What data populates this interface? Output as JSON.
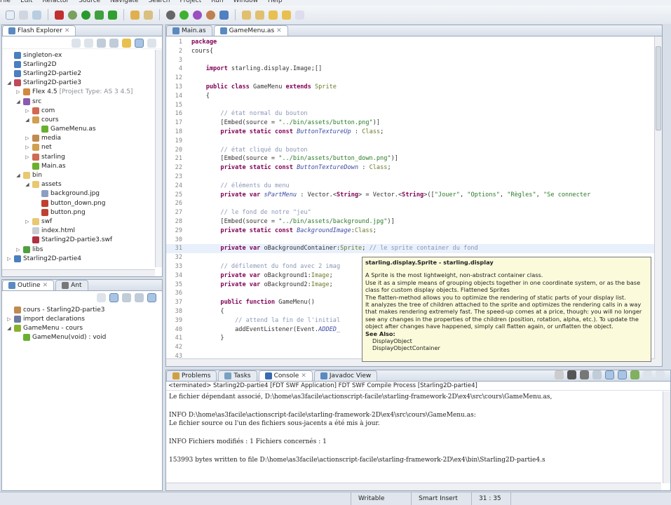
{
  "menu": [
    "File",
    "Edit",
    "Refactor",
    "Source",
    "Navigate",
    "Search",
    "Project",
    "Run",
    "Window",
    "Help"
  ],
  "explorer": {
    "tab": "Flash Explorer",
    "items": [
      {
        "label": "singleton-ex",
        "depth": 0,
        "tw": "",
        "icon": "#4a7fc0"
      },
      {
        "label": "Starling2D",
        "depth": 0,
        "tw": "",
        "icon": "#4a7fc0"
      },
      {
        "label": "Starling2D-partie2",
        "depth": 0,
        "tw": "",
        "icon": "#4a7fc0"
      },
      {
        "label": "Starling2D-partie3",
        "depth": 0,
        "tw": "◢",
        "icon": "#c04a5a"
      },
      {
        "label": "Flex 4.5",
        "extra": "[Project Type: AS 3 4.5]",
        "depth": 1,
        "tw": "▷",
        "icon": "#d08a40"
      },
      {
        "label": "src",
        "depth": 1,
        "tw": "◢",
        "icon": "#8a5ab0"
      },
      {
        "label": "com",
        "depth": 2,
        "tw": "▷",
        "icon": "#d06a50"
      },
      {
        "label": "cours",
        "depth": 2,
        "tw": "◢",
        "icon": "#d0a050"
      },
      {
        "label": "GameMenu.as",
        "depth": 3,
        "tw": "",
        "icon": "#6ab030"
      },
      {
        "label": "media",
        "depth": 2,
        "tw": "▷",
        "icon": "#c08a50"
      },
      {
        "label": "net",
        "depth": 2,
        "tw": "▷",
        "icon": "#d0a050"
      },
      {
        "label": "starling",
        "depth": 2,
        "tw": "▷",
        "icon": "#d06a50"
      },
      {
        "label": "Main.as",
        "depth": 2,
        "tw": "",
        "icon": "#6ab030"
      },
      {
        "label": "bin",
        "depth": 1,
        "tw": "◢",
        "icon": "#e8c870"
      },
      {
        "label": "assets",
        "depth": 2,
        "tw": "◢",
        "icon": "#e8c870"
      },
      {
        "label": "background.jpg",
        "depth": 3,
        "tw": "",
        "icon": "#8aa0c0"
      },
      {
        "label": "button_down.png",
        "depth": 3,
        "tw": "",
        "icon": "#c04030"
      },
      {
        "label": "button.png",
        "depth": 3,
        "tw": "",
        "icon": "#c04030"
      },
      {
        "label": "swf",
        "depth": 2,
        "tw": "▷",
        "icon": "#e8c870"
      },
      {
        "label": "index.html",
        "depth": 2,
        "tw": "",
        "icon": "#c8ccd4"
      },
      {
        "label": "Starling2D-partie3.swf",
        "depth": 2,
        "tw": "",
        "icon": "#b03040"
      },
      {
        "label": "libs",
        "depth": 1,
        "tw": "▷",
        "icon": "#50a040"
      },
      {
        "label": "Starling2D-partie4",
        "depth": 0,
        "tw": "▷",
        "icon": "#4a7fc0"
      }
    ]
  },
  "outline": {
    "tabs": [
      "Outline",
      "Ant"
    ],
    "items": [
      {
        "label": "cours - Starling2D-partie3",
        "depth": 0,
        "tw": "",
        "icon": "#c08a50"
      },
      {
        "label": "import declarations",
        "depth": 0,
        "tw": "▷",
        "icon": "#6a7aa0"
      },
      {
        "label": "GameMenu - cours",
        "depth": 0,
        "tw": "◢",
        "icon": "#8ab030"
      },
      {
        "label": "GameMenu(void) : void",
        "depth": 1,
        "tw": "",
        "icon": "#6ab030"
      }
    ]
  },
  "editor": {
    "tabs": [
      "Main.as",
      "GameMenu.as"
    ],
    "active_tab": 1,
    "lines": [
      {
        "n": "1",
        "s": [
          [
            "kw",
            "package"
          ]
        ]
      },
      {
        "n": "2",
        "s": [
          [
            "df",
            "cours{"
          ]
        ]
      },
      {
        "n": "3",
        "s": []
      },
      {
        "n": "4",
        "s": [
          [
            "df",
            "    "
          ],
          [
            "kw",
            "import"
          ],
          [
            "df",
            " starling.display.Image;[]"
          ]
        ]
      },
      {
        "n": "12",
        "s": []
      },
      {
        "n": "13",
        "s": [
          [
            "df",
            "    "
          ],
          [
            "kw",
            "public class"
          ],
          [
            "df",
            " GameMenu "
          ],
          [
            "kw",
            "extends"
          ],
          [
            "ty",
            " Sprite"
          ]
        ]
      },
      {
        "n": "14",
        "s": [
          [
            "df",
            "    {"
          ]
        ]
      },
      {
        "n": "15",
        "s": []
      },
      {
        "n": "16",
        "s": [
          [
            "cm",
            "        // état normal du bouton"
          ]
        ]
      },
      {
        "n": "17",
        "s": [
          [
            "df",
            "        [Embed(source = "
          ],
          [
            "st",
            "\"../bin/assets/button.png\""
          ],
          [
            "df",
            ")]"
          ]
        ]
      },
      {
        "n": "18",
        "s": [
          [
            "df",
            "        "
          ],
          [
            "kw",
            "private static const"
          ],
          [
            "it",
            " ButtonTextureUp"
          ],
          [
            "df",
            " : "
          ],
          [
            "ty",
            "Class"
          ],
          [
            "df",
            ";"
          ]
        ]
      },
      {
        "n": "19",
        "s": []
      },
      {
        "n": "20",
        "s": [
          [
            "cm",
            "        // état cliqué du bouton"
          ]
        ]
      },
      {
        "n": "21",
        "s": [
          [
            "df",
            "        [Embed(source = "
          ],
          [
            "st",
            "\"../bin/assets/button_down.png\""
          ],
          [
            "df",
            ")]"
          ]
        ]
      },
      {
        "n": "22",
        "s": [
          [
            "df",
            "        "
          ],
          [
            "kw",
            "private static const"
          ],
          [
            "it",
            " ButtonTextureDown"
          ],
          [
            "df",
            " : "
          ],
          [
            "ty",
            "Class"
          ],
          [
            "df",
            ";"
          ]
        ]
      },
      {
        "n": "23",
        "s": []
      },
      {
        "n": "24",
        "s": [
          [
            "cm",
            "        // éléments du menu"
          ]
        ]
      },
      {
        "n": "25",
        "s": [
          [
            "df",
            "        "
          ],
          [
            "kw",
            "private var"
          ],
          [
            "it",
            " sPartMenu"
          ],
          [
            "df",
            " : Vector.<"
          ],
          [
            "kw",
            "String"
          ],
          [
            "df",
            "> = Vector.<"
          ],
          [
            "kw",
            "String"
          ],
          [
            "df",
            ">(["
          ],
          [
            "st",
            "\"Jouer\""
          ],
          [
            "df",
            ", "
          ],
          [
            "st",
            "\"Options\""
          ],
          [
            "df",
            ", "
          ],
          [
            "st",
            "\"Règles\""
          ],
          [
            "df",
            ", "
          ],
          [
            "st",
            "\"Se connecter"
          ]
        ]
      },
      {
        "n": "26",
        "s": []
      },
      {
        "n": "27",
        "s": [
          [
            "cm",
            "        // le fond de notre \"jeu\""
          ]
        ]
      },
      {
        "n": "28",
        "s": [
          [
            "df",
            "        [Embed(source = "
          ],
          [
            "st",
            "\"../bin/assets/background.jpg\""
          ],
          [
            "df",
            ")]"
          ]
        ]
      },
      {
        "n": "29",
        "s": [
          [
            "df",
            "        "
          ],
          [
            "kw",
            "private static const"
          ],
          [
            "it",
            " BackgroundImage"
          ],
          [
            "df",
            ":"
          ],
          [
            "ty",
            "Class"
          ],
          [
            "df",
            ";"
          ]
        ]
      },
      {
        "n": "30",
        "s": []
      },
      {
        "n": "31",
        "s": [
          [
            "df",
            "        "
          ],
          [
            "kw",
            "private var"
          ],
          [
            "df",
            " oBackgroundContainer:"
          ],
          [
            "ty",
            "Sprite"
          ],
          [
            "df",
            "; "
          ],
          [
            "cm",
            "// le sprite container du fond"
          ]
        ],
        "current": true
      },
      {
        "n": "32",
        "s": []
      },
      {
        "n": "33",
        "s": [
          [
            "cm",
            "        // défilement du fond avec 2 imag"
          ]
        ]
      },
      {
        "n": "34",
        "s": [
          [
            "df",
            "        "
          ],
          [
            "kw",
            "private var"
          ],
          [
            "df",
            " oBackground1:"
          ],
          [
            "ty",
            "Image"
          ],
          [
            "df",
            ";"
          ]
        ]
      },
      {
        "n": "35",
        "s": [
          [
            "df",
            "        "
          ],
          [
            "kw",
            "private var"
          ],
          [
            "df",
            " oBackground2:"
          ],
          [
            "ty",
            "Image"
          ],
          [
            "df",
            ";"
          ]
        ]
      },
      {
        "n": "36",
        "s": []
      },
      {
        "n": "37",
        "s": [
          [
            "df",
            "        "
          ],
          [
            "kw",
            "public function"
          ],
          [
            "df",
            " GameMenu()"
          ]
        ]
      },
      {
        "n": "38",
        "s": [
          [
            "df",
            "        {"
          ]
        ]
      },
      {
        "n": "39",
        "s": [
          [
            "cm",
            "            // attend la fin de l'initial"
          ]
        ]
      },
      {
        "n": "40",
        "s": [
          [
            "df",
            "            addEventListener(Event."
          ],
          [
            "it",
            "ADDED_"
          ]
        ]
      },
      {
        "n": "41",
        "s": [
          [
            "df",
            "        }"
          ]
        ]
      },
      {
        "n": "42",
        "s": []
      },
      {
        "n": "43",
        "s": []
      }
    ]
  },
  "tooltip": {
    "title": "starling.display.Sprite - starling.display",
    "paragraphs": [
      "A Sprite is the most lightweight, non-abstract container class.",
      "Use it as a simple means of grouping objects together in one coordinate system, or as the base class for custom display objects. Flattened Sprites",
      "The flatten-method allows you to optimize the rendering of static parts of your display list.",
      "It analyzes the tree of children attached to the sprite and optimizes the rendering calls in a way that makes rendering extremely fast. The speed-up comes at a price, though: you will no longer see any changes in the properties of the children (position, rotation, alpha, etc.). To update the object after changes have happened, simply call flatten again, or unflatten the object."
    ],
    "see_also_label": "See Also:",
    "see_also": [
      "DisplayObject",
      "DisplayObjectContainer"
    ]
  },
  "console": {
    "tabs": [
      "Problems",
      "Tasks",
      "Console",
      "Javadoc View"
    ],
    "active_tab": 2,
    "header": "<terminated> Starling2D-partie4 [FDT SWF Application] FDT SWF Compile Process [Starling2D-partie4]",
    "lines": [
      "Le fichier dépendant associé, D:\\home\\as3facile\\actionscript-facile\\starling-framework-2D\\ex4\\src\\cours\\GameMenu.as,",
      "",
      "INFO D:\\home\\as3facile\\actionscript-facile\\starling-framework-2D\\ex4\\src\\cours\\GameMenu.as:",
      "Le fichier source ou l'un des fichiers sous-jacents a été mis à jour.",
      "",
      "INFO Fichiers modifiés : 1 Fichiers concernés : 1",
      "",
      "153993 bytes written to file D:\\home\\as3facile\\actionscript-facile\\starling-framework-2D\\ex4\\bin\\Starling2D-partie4.s"
    ]
  },
  "status": {
    "mode": "Writable",
    "insert": "Smart Insert",
    "position": "31 : 35"
  }
}
